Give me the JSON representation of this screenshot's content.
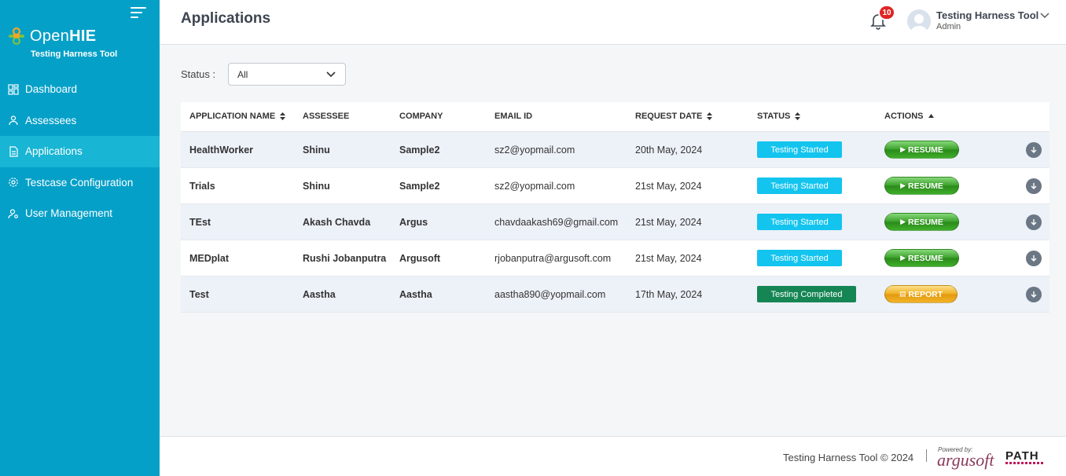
{
  "sidebar": {
    "logo": {
      "open": "Open",
      "hie": "HIE",
      "subtitle": "Testing Harness Tool"
    },
    "items": [
      {
        "label": "Dashboard",
        "icon": "dashboard-icon"
      },
      {
        "label": "Assessees",
        "icon": "user-icon"
      },
      {
        "label": "Applications",
        "icon": "document-icon",
        "active": true
      },
      {
        "label": "Testcase Configuration",
        "icon": "gear-icon"
      },
      {
        "label": "User Management",
        "icon": "user-settings-icon"
      }
    ]
  },
  "header": {
    "title": "Applications",
    "notifications_count": "10",
    "user_name": "Testing Harness Tool",
    "user_role": "Admin"
  },
  "filter": {
    "label": "Status :",
    "selected": "All"
  },
  "table": {
    "columns": [
      "APPLICATION NAME",
      "ASSESSEE",
      "COMPANY",
      "EMAIL ID",
      "REQUEST DATE",
      "STATUS",
      "ACTIONS"
    ],
    "rows": [
      {
        "app": "HealthWorker",
        "assessee": "Shinu",
        "company": "Sample2",
        "email": "sz2@yopmail.com",
        "date": "20th May, 2024",
        "status": "Testing Started",
        "action": "RESUME"
      },
      {
        "app": "Trials",
        "assessee": "Shinu",
        "company": "Sample2",
        "email": "sz2@yopmail.com",
        "date": "21st May, 2024",
        "status": "Testing Started",
        "action": "RESUME"
      },
      {
        "app": "TEst",
        "assessee": "Akash Chavda",
        "company": "Argus",
        "email": "chavdaakash69@gmail.com",
        "date": "21st May, 2024",
        "status": "Testing Started",
        "action": "RESUME"
      },
      {
        "app": "MEDplat",
        "assessee": "Rushi Jobanputra",
        "company": "Argusoft",
        "email": "rjobanputra@argusoft.com",
        "date": "21st May, 2024",
        "status": "Testing Started",
        "action": "RESUME"
      },
      {
        "app": "Test",
        "assessee": "Aastha",
        "company": "Aastha",
        "email": "aastha890@yopmail.com",
        "date": "17th May, 2024",
        "status": "Testing Completed",
        "action": "REPORT"
      }
    ]
  },
  "footer": {
    "copyright": "Testing Harness Tool © 2024",
    "powered_by": "Powered by:",
    "argusoft": "argusoft",
    "path": "PATH"
  },
  "colors": {
    "sidebar": "#05a0c8",
    "sidebar_active": "#18b5d4",
    "status_started": "#13c4ef",
    "status_completed": "#158554",
    "badge": "#e02424"
  }
}
